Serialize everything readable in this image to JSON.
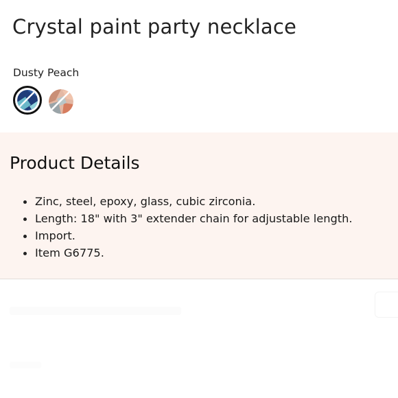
{
  "product": {
    "title": "Crystal paint party necklace",
    "selected_color": "Dusty Peach"
  },
  "swatches": [
    {
      "icon": "crystal-swatch-icon",
      "state": "selected",
      "colors": [
        "#1f3d7a",
        "#6ab7c8",
        "#ffffff"
      ]
    },
    {
      "icon": "crystal-swatch-icon",
      "state": "unselected",
      "colors": [
        "#e8a98c",
        "#9aa4a8",
        "#ffffff"
      ]
    }
  ],
  "details": {
    "heading": "Product Details",
    "items": [
      "Zinc, steel, epoxy, glass, cubic zirconia.",
      "Length: 18\" with 3\" extender chain for adjustable length.",
      "Import.",
      "Item G6775."
    ]
  },
  "theme": {
    "details_bg": "#fdf4f0",
    "text": "#1a1a1a"
  }
}
